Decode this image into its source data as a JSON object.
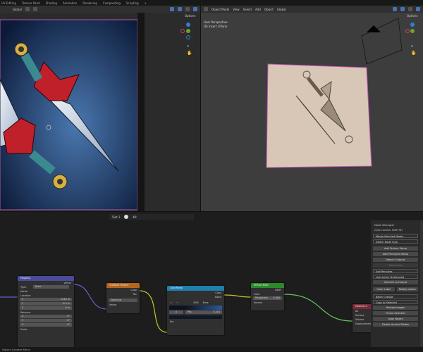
{
  "workspace_tabs": [
    "UV Editing",
    "Texture Paint",
    "Shading",
    "Animation",
    "Rendering",
    "Compositing",
    "Scripting",
    "+"
  ],
  "image_editor": {
    "orientation": "Global",
    "options": "Options"
  },
  "viewport": {
    "mode": "Object Mode",
    "menus": [
      "View",
      "Select",
      "Add",
      "Object"
    ],
    "orientation": "Global",
    "options": "Options",
    "overlay_line1": "User Perspective",
    "overlay_line2": "(6) Insert | Plane"
  },
  "node_header": {
    "slot": "Slot 1",
    "material": "Kit"
  },
  "nodes": {
    "mapping": {
      "title": "Mapping",
      "out_vector": "Vector",
      "type_label": "Type:",
      "type_value": "Point",
      "in_vector": "Vector",
      "location": "Location:",
      "loc": [
        [
          "X",
          "-0.65 m"
        ],
        [
          "Y",
          "-0.3 m"
        ],
        [
          "Z",
          "0 m"
        ]
      ],
      "rotation": "Rotation:",
      "rot": [
        [
          "X",
          "0°"
        ],
        [
          "Y",
          "0°"
        ],
        [
          "Z",
          "0°"
        ]
      ],
      "scale": "Scale:"
    },
    "gradient": {
      "title": "Gradient Texture",
      "out_color": "Color",
      "out_fac": "Fac",
      "type": "Spherical",
      "in_vector": "Vector"
    },
    "colorramp": {
      "title": "ColorRamp",
      "out_color": "Color",
      "out_alpha": "Alpha",
      "mode": "RGB",
      "interp": "Ease",
      "index": "0",
      "pos_label": "Pos",
      "pos_value": "0.418",
      "in_fac": "Fac"
    },
    "diffuse": {
      "title": "Diffuse BSDF",
      "out": "BSDF",
      "in_color": "Color",
      "roughness_label": "Roughness",
      "roughness_value": "0.000",
      "in_normal": "Normal"
    },
    "output": {
      "title": "Material O",
      "target": "All",
      "surface": "Surface",
      "volume": "Volume",
      "displacement": "Displacement"
    }
  },
  "node_wrangler": {
    "title": "Node Wrangler",
    "quick": "(Quick access: Shift+W)",
    "items": [
      "Merge Selected Nodes",
      "Switch Node Type",
      "Add Texture Setup",
      "Add Principled Setup",
      "Detach Outputs",
      "Swap Links",
      "Add Reroutes",
      "Link Active To Selected",
      "Connect to Output",
      "Clear Label",
      "Modify Labels",
      "Batch Change",
      "Copy to Selected",
      "Reload Images",
      "Frame Selected",
      "Align Nodes",
      "Delete Unused Nodes"
    ]
  },
  "status_bar": "Object Context Menu"
}
